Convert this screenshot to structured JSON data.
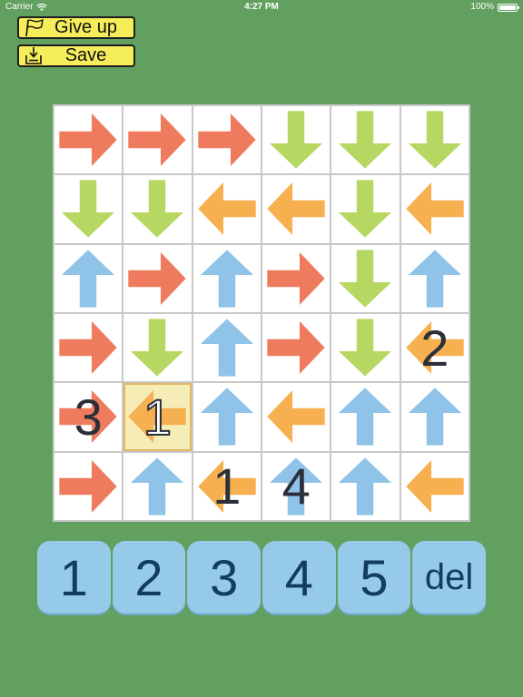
{
  "status_bar": {
    "carrier": "Carrier",
    "time": "4:27 PM",
    "battery": "100%",
    "battery_level": 1.0
  },
  "toolbar": {
    "give_up_label": "Give up",
    "give_up_icon": "flag-icon",
    "save_label": "Save",
    "save_icon": "download-tray-icon"
  },
  "colors": {
    "background": "#62a05f",
    "right_arrow": "#ef7b5f",
    "down_arrow": "#b6d862",
    "left_arrow": "#f6b04f",
    "up_arrow": "#8fc3e8",
    "button_yellow": "#f5ee5a",
    "pad_key": "#95cbe9",
    "selected_cell": "#f6edb6"
  },
  "board": {
    "rows": [
      [
        "right",
        "right",
        "right",
        "down",
        "down",
        "down"
      ],
      [
        "down",
        "down",
        "left",
        "left",
        "down",
        "left"
      ],
      [
        "up",
        "right",
        "up",
        "right",
        "down",
        "up"
      ],
      [
        "right",
        "down",
        "up",
        "right",
        "down",
        "left"
      ],
      [
        "right",
        "left",
        "up",
        "left",
        "up",
        "up"
      ],
      [
        "right",
        "up",
        "left",
        "up",
        "up",
        "left"
      ]
    ],
    "numbers": [
      [
        "",
        "",
        "",
        "",
        "",
        ""
      ],
      [
        "",
        "",
        "",
        "",
        "",
        ""
      ],
      [
        "",
        "",
        "",
        "",
        "",
        ""
      ],
      [
        "",
        "",
        "",
        "",
        "",
        "2"
      ],
      [
        "3",
        "1",
        "",
        "",
        "",
        ""
      ],
      [
        "",
        "",
        "1",
        "4",
        "",
        ""
      ]
    ],
    "selected": {
      "row": 4,
      "col": 1
    }
  },
  "keypad": {
    "keys": [
      "1",
      "2",
      "3",
      "4",
      "5",
      "del"
    ]
  }
}
